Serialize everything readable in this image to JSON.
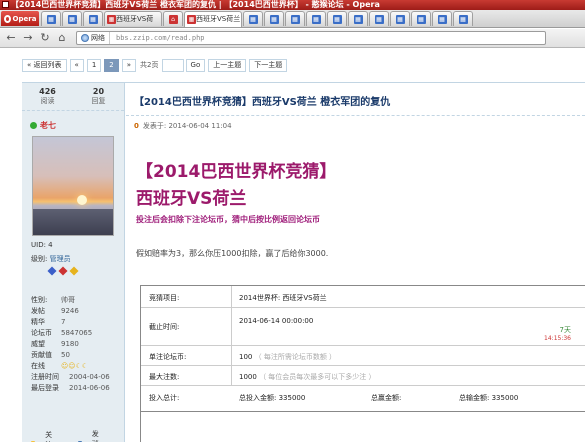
{
  "window": {
    "title": "【2014巴西世界杯竞猜】西班牙VS荷兰  橙衣军团的复仇 | 【2014巴西世界杯】 - 憨猴论坛 - Opera"
  },
  "browser": {
    "menu_label": "Opera",
    "tabs": [
      {
        "label": "",
        "favicon": "forum-icon"
      },
      {
        "label": "",
        "favicon": "forum-icon"
      },
      {
        "label": "",
        "favicon": "forum-icon"
      },
      {
        "label": "西班牙VS荷",
        "favicon": "forum-icon",
        "active": false
      },
      {
        "label": "",
        "favicon": "home-icon"
      },
      {
        "label": "西班牙VS荷兰",
        "favicon": "forum-icon",
        "active": true
      },
      {
        "label": "",
        "favicon": "forum-icon"
      },
      {
        "label": "",
        "favicon": "forum-icon"
      },
      {
        "label": "",
        "favicon": "forum-icon"
      },
      {
        "label": "",
        "favicon": "forum-icon"
      },
      {
        "label": "",
        "favicon": "forum-icon"
      },
      {
        "label": "",
        "favicon": "forum-icon"
      },
      {
        "label": "",
        "favicon": "forum-icon"
      },
      {
        "label": "",
        "favicon": "forum-icon"
      },
      {
        "label": "",
        "favicon": "forum-icon"
      },
      {
        "label": "",
        "favicon": "forum-icon"
      },
      {
        "label": "",
        "favicon": "forum-icon"
      }
    ],
    "address": {
      "security_label": "网络",
      "url": "bbs.zzip.com/read.php"
    }
  },
  "pager": {
    "back": "« 返回列表",
    "prev": "«",
    "page1": "1",
    "page2": "2",
    "next": "»",
    "total": "共2页",
    "go": "Go",
    "prev_thread": "上一主题",
    "next_thread": "下一主题"
  },
  "author": {
    "views_count": "426",
    "views_label": "阅读",
    "replies_count": "20",
    "replies_label": "回复",
    "name": "老七",
    "uid_label": "UID: 4",
    "group_prefix": "级别:",
    "group": "管理员",
    "fields": [
      {
        "k": "性别:",
        "v": "帅哥"
      },
      {
        "k": "发帖",
        "v": "9246"
      },
      {
        "k": "精华",
        "v": "7"
      },
      {
        "k": "论坛币",
        "v": "5847065"
      },
      {
        "k": "威望",
        "v": "9180"
      },
      {
        "k": "贡献值",
        "v": "50"
      },
      {
        "k": "在线",
        "v": ""
      },
      {
        "k": "注册时间",
        "v": "2004-04-06"
      },
      {
        "k": "最后登录",
        "v": "2014-06-06"
      }
    ],
    "follow": "关注Ta",
    "message": "发消息"
  },
  "post": {
    "thread_title": "【2014巴西世界杯竞猜】西班牙VS荷兰    橙衣军团的复仇",
    "floor": "0",
    "posted_at": "发表于: 2014-06-04 11:04",
    "headline1": "【2014巴西世界杯竞猜】",
    "headline2": "西班牙VS荷兰",
    "promo": "投注后会扣除下注论坛币，猜中后按比例返回论坛币",
    "odds": "假如赔率为3，那么你压1000扣除，赢了后给你3000."
  },
  "guess": {
    "item_label": "竞猜项目:",
    "item_value": "2014世界杯: 西班牙VS荷兰",
    "deadline_label": "截止时间:",
    "deadline_value": "2014-06-14  00:00:00",
    "days_left": "7天",
    "time_left": "14:15:36",
    "unit_label": "单注论坛币:",
    "unit_value": "100",
    "unit_hint": "（ 每注所需论坛币数额 ）",
    "max_label": "最大注数:",
    "max_value": "1000",
    "max_hint": "（ 每位会员每次最多可以下多少注 ）",
    "total_label": "投入总计:",
    "total_in": "总投入金额:  335000",
    "total_win": "总赢金额:",
    "total_lose": "总输金额:  335000"
  }
}
